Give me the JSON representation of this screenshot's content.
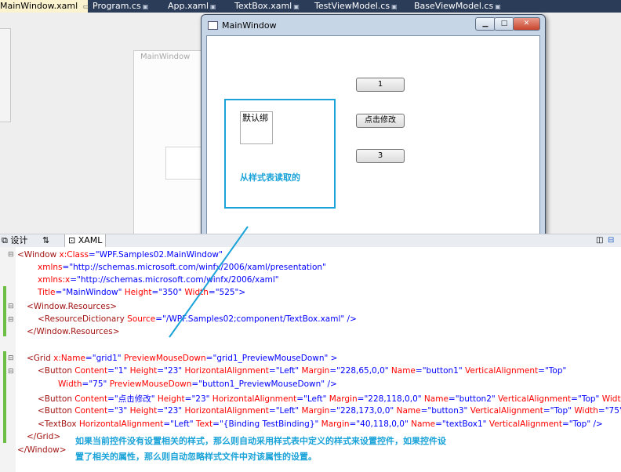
{
  "tabs": [
    {
      "label": "MainWindow.xaml",
      "active": true
    },
    {
      "label": "Program.cs"
    },
    {
      "label": "App.xaml"
    },
    {
      "label": "TextBox.xaml"
    },
    {
      "label": "TestViewModel.cs"
    },
    {
      "label": "BaseViewModel.cs"
    }
  ],
  "designer": {
    "background_window_title": "MainWindow"
  },
  "app_window": {
    "title": "MainWindow",
    "buttons": [
      "1",
      "点击修改",
      "3"
    ],
    "textbox_text": "默认绑",
    "annotation": "从样式表读取的"
  },
  "view_tabs": {
    "design": "设计",
    "swap": "⇅",
    "xaml": "XAML"
  },
  "code": {
    "l1": [
      "<Window",
      " x:Class",
      "=",
      "\"WPF.Samples02.MainWindow\""
    ],
    "l2": [
      "xmlns",
      "=",
      "\"http://schemas.microsoft.com/winfx/2006/xaml/presentation\""
    ],
    "l3": [
      "xmlns:x",
      "=",
      "\"http://schemas.microsoft.com/winfx/2006/xaml\""
    ],
    "l4": [
      "Title",
      "=",
      "\"MainWindow\"",
      " Height",
      "=",
      "\"350\"",
      " Width",
      "=",
      "\"525\"",
      ">"
    ],
    "l5": [
      "<Window.Resources>"
    ],
    "l6": [
      "<ResourceDictionary",
      " Source",
      "=",
      "\"/WPF.Samples02;component/TextBox.xaml\"",
      " />"
    ],
    "l7": [
      "</Window.Resources>"
    ],
    "l8": [
      "<Grid",
      "   x:Name",
      "=",
      "\"grid1\"",
      " PreviewMouseDown",
      "=",
      "\"grid1_PreviewMouseDown\"",
      " >"
    ],
    "l9": [
      "<Button",
      " Content",
      "=",
      "\"1\"",
      " Height",
      "=",
      "\"23\"",
      "  HorizontalAlignment",
      "=",
      "\"Left\"",
      " Margin",
      "=",
      "\"228,65,0,0\"",
      " Name",
      "=",
      "\"button1\"",
      " VerticalAlignment",
      "=",
      "\"Top\""
    ],
    "l10": [
      "Width",
      "=",
      "\"75\"",
      " PreviewMouseDown",
      "=",
      "\"button1_PreviewMouseDown\"",
      " />"
    ],
    "l11": [
      "<Button",
      " Content",
      "=",
      "\"点击修改\"",
      " Height",
      "=",
      "\"23\"",
      " HorizontalAlignment",
      "=",
      "\"Left\"",
      " Margin",
      "=",
      "\"228,118,0,0\"",
      " Name",
      "=",
      "\"button2\"",
      " VerticalAlignment",
      "=",
      "\"Top\"",
      " Widt"
    ],
    "l12": [
      "<Button",
      " Content",
      "=",
      "\"3\"",
      " Height",
      "=",
      "\"23\"",
      " HorizontalAlignment",
      "=",
      "\"Left\"",
      " Margin",
      "=",
      "\"228,173,0,0\"",
      " Name",
      "=",
      "\"button3\"",
      " VerticalAlignment",
      "=",
      "\"Top\"",
      " Width",
      "=",
      "\"75\""
    ],
    "l13": [
      "<TextBox",
      "  HorizontalAlignment",
      "=",
      "\"Left\"",
      " Text",
      "=",
      "\"{Binding TestBinding}\"",
      " Margin",
      "=",
      "\"40,118,0,0\"",
      " Name",
      "=",
      "\"textBox1\"",
      " VerticalAlignment",
      "=",
      "\"Top\"",
      "  />"
    ],
    "l14": [
      "</Grid>"
    ],
    "l15": [
      "</Window>"
    ]
  },
  "note": [
    "如果当前控件没有设置相关的样式，那么则自动采用样式表中定义的样式来设置控件，如果控件设",
    "置了相关的属性，那么则自动忽略样式文件中对该属性的设置。"
  ],
  "colors": {
    "accent_annotation": "#1aa3d8",
    "tab_bar": "#2b3c59"
  }
}
